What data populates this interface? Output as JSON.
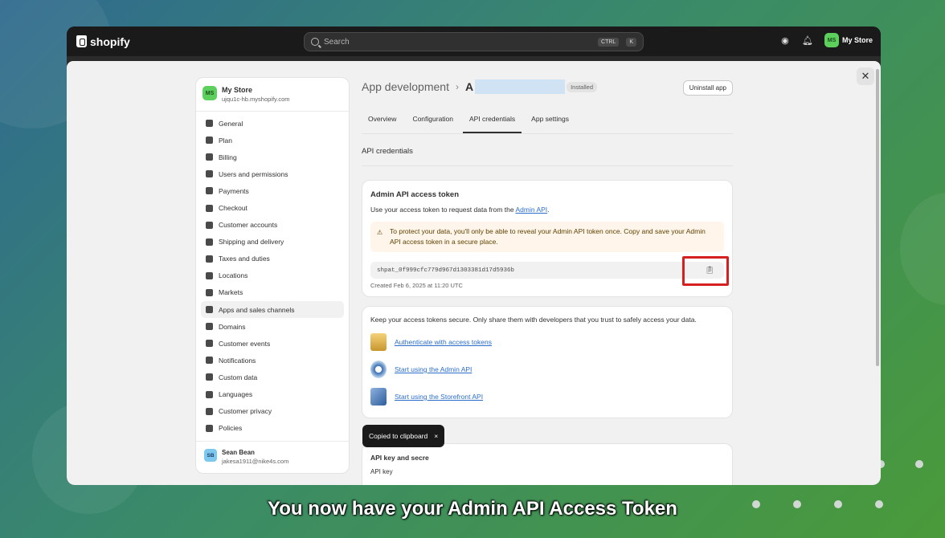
{
  "topbar": {
    "logo_text": "shopify",
    "search_placeholder": "Search",
    "shortcut_keys": [
      "CTRL",
      "K"
    ],
    "store_avatar": "MS",
    "store_label": "My Store"
  },
  "sidebar": {
    "store_avatar": "MS",
    "store_name": "My Store",
    "store_url": "ujqu1c-hb.myshopify.com",
    "items": [
      {
        "label": "General"
      },
      {
        "label": "Plan"
      },
      {
        "label": "Billing"
      },
      {
        "label": "Users and permissions"
      },
      {
        "label": "Payments"
      },
      {
        "label": "Checkout"
      },
      {
        "label": "Customer accounts"
      },
      {
        "label": "Shipping and delivery"
      },
      {
        "label": "Taxes and duties"
      },
      {
        "label": "Locations"
      },
      {
        "label": "Markets"
      },
      {
        "label": "Apps and sales channels"
      },
      {
        "label": "Domains"
      },
      {
        "label": "Customer events"
      },
      {
        "label": "Notifications"
      },
      {
        "label": "Custom data"
      },
      {
        "label": "Languages"
      },
      {
        "label": "Customer privacy"
      },
      {
        "label": "Policies"
      }
    ],
    "active_item": "Apps and sales channels",
    "user_avatar": "SB",
    "user_name": "Sean Bean",
    "user_email": "jakesa1911@nike4s.com"
  },
  "header": {
    "breadcrumb_parent": "App development",
    "app_name_initial": "A",
    "status_badge": "Installed",
    "uninstall_label": "Uninstall app"
  },
  "tabs": [
    {
      "label": "Overview"
    },
    {
      "label": "Configuration"
    },
    {
      "label": "API credentials"
    },
    {
      "label": "App settings"
    }
  ],
  "active_tab": "API credentials",
  "section_title": "API credentials",
  "token_card": {
    "title": "Admin API access token",
    "description_prefix": "Use your access token to request data from the ",
    "description_link": "Admin API",
    "description_suffix": ".",
    "warning": "To protect your data, you'll only be able to reveal your Admin API token once. Copy and save your Admin API access token in a secure place.",
    "token_value": "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",
    "created": "Created Feb 6, 2025 at 11:20 UTC"
  },
  "resources_card": {
    "intro": "Keep your access tokens secure. Only share them with developers that you trust to safely access your data.",
    "links": [
      {
        "label": "Authenticate with access tokens",
        "icon": "coin-icon"
      },
      {
        "label": "Start using the Admin API",
        "icon": "gear-icon"
      },
      {
        "label": "Start using the Storefront API",
        "icon": "document-icon"
      }
    ]
  },
  "keys_card": {
    "title": "API key and secre",
    "api_key_label": "API key"
  },
  "toast": {
    "message": "Copied to clipboard",
    "close": "×"
  },
  "caption": "You now have your Admin API Access Token"
}
